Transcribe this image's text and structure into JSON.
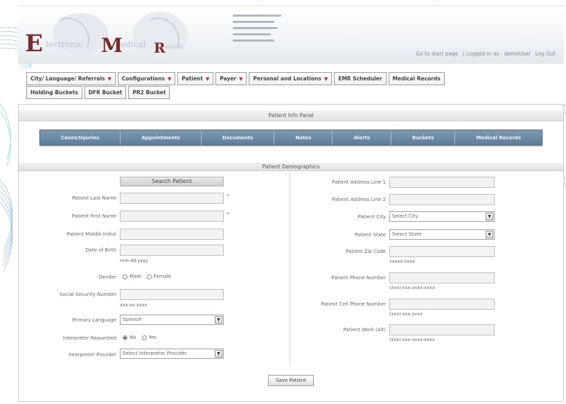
{
  "logo": {
    "letter_e": "E",
    "word_e": "lectronic",
    "letter_m": "M",
    "word_m": "edical",
    "letter_r": "R",
    "word_r": "ecords"
  },
  "top_links": {
    "start": "Go to start page",
    "logged": "| Logged in as - demoUser",
    "logout": "Log Out"
  },
  "nav": {
    "row1": [
      {
        "label": "City/ Language/ Referrals",
        "caret": true
      },
      {
        "label": "Configurations",
        "caret": true
      },
      {
        "label": "Patient",
        "caret": true
      },
      {
        "label": "Payer",
        "caret": true
      },
      {
        "label": "Personal and Locations",
        "caret": true
      },
      {
        "label": "EMR Scheduler",
        "caret": false
      },
      {
        "label": "Medical Records",
        "caret": false
      }
    ],
    "row2": [
      {
        "label": "Holding Buckets"
      },
      {
        "label": "DFR Bucket"
      },
      {
        "label": "PR2 Bucket"
      }
    ]
  },
  "panel": {
    "title": "Patient Info Panel",
    "demographics_title": "Patient Demographics"
  },
  "tabs": [
    "Cases/Injuries",
    "Appointments",
    "Documents",
    "Notes",
    "Alerts",
    "Buckets",
    "Medical Records"
  ],
  "left": {
    "search_button": "Search Patient",
    "last_name": "Patient Last Name",
    "first_name": "Patient First Name",
    "middle_initial": "Patient Middle Initial",
    "dob": "Date of Birth",
    "dob_hint": "mm-dd-yyyy",
    "gender": "Gender",
    "gender_male": "Male",
    "gender_female": "Female",
    "ssn": "Social Security Number",
    "ssn_hint": "xxx-xx-xxxx",
    "language": "Primary Language",
    "language_value": "Spanish",
    "interpreter": "Interpreter Requested",
    "interp_no": "No",
    "interp_yes": "Yes",
    "provider": "Interpreter Provider",
    "provider_value": "Select Interpreter Provider",
    "required_mark": "*"
  },
  "right": {
    "addr1": "Patient Address Line 1",
    "addr2": "Patient Address Line 2",
    "city": "Patient City",
    "city_value": "Select City",
    "state": "Patient State",
    "state_value": "Select State",
    "zip": "Patient Zip Code",
    "zip_hint": "xxxxx-xxxx",
    "phone": "Patient Phone Number",
    "phone_hint": "(xxx) xxx-xxxx-xxxx",
    "cell": "Patient Cell Phone Number",
    "cell_hint": "(xxx) xxx-xxxx",
    "work": "Patient Work (Alt)",
    "work_hint": "(xxx) xxx-xxxx-xxxx"
  },
  "save_button": "Save Patient",
  "icons": {
    "dropdown": "dropdown-arrow-icon"
  }
}
